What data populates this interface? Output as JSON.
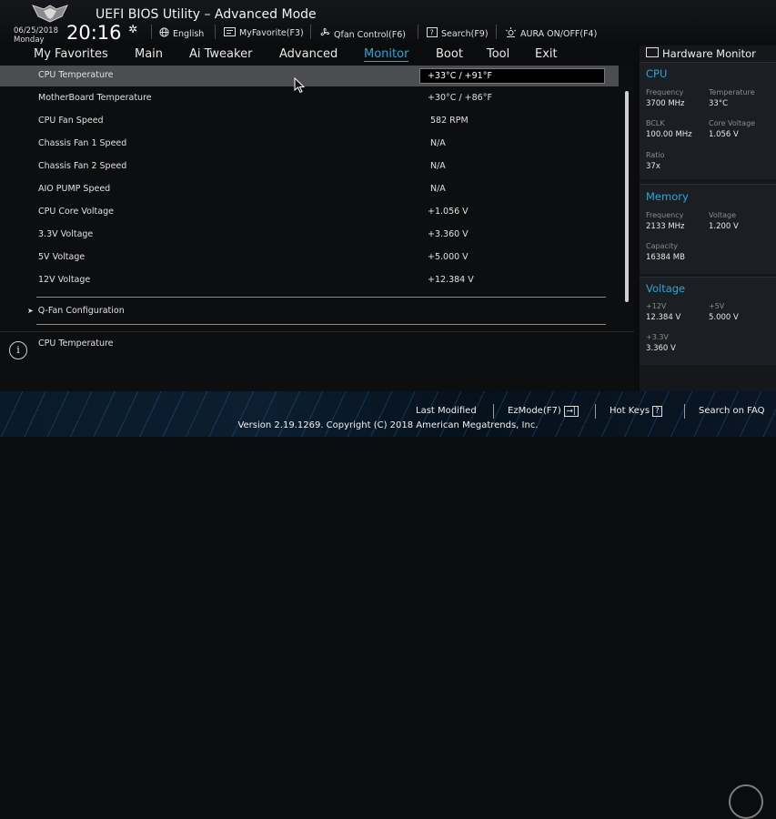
{
  "app": {
    "title": "UEFI BIOS Utility – Advanced Mode",
    "date": "06/25/2018",
    "day": "Monday",
    "time": "20:16"
  },
  "toolbar": [
    {
      "label": "English",
      "icon": "globe-icon"
    },
    {
      "label": "MyFavorite(F3)",
      "icon": "favorite-icon"
    },
    {
      "label": "Qfan Control(F6)",
      "icon": "fan-icon"
    },
    {
      "label": "Search(F9)",
      "icon": "search-icon"
    },
    {
      "label": "AURA ON/OFF(F4)",
      "icon": "aura-icon"
    }
  ],
  "nav": {
    "tabs": [
      "My Favorites",
      "Main",
      "Ai Tweaker",
      "Advanced",
      "Monitor",
      "Boot",
      "Tool",
      "Exit"
    ],
    "active": "Monitor"
  },
  "monitor": {
    "rows": [
      {
        "label": "CPU Temperature",
        "value": "+33°C / +91°F"
      },
      {
        "label": "MotherBoard Temperature",
        "value": "+30°C / +86°F"
      },
      {
        "label": "CPU Fan Speed",
        "value": "582 RPM"
      },
      {
        "label": "Chassis Fan 1 Speed",
        "value": "N/A"
      },
      {
        "label": "Chassis Fan 2 Speed",
        "value": "N/A"
      },
      {
        "label": "AIO PUMP Speed",
        "value": "N/A"
      },
      {
        "label": "CPU Core Voltage",
        "value": "+1.056 V"
      },
      {
        "label": "3.3V Voltage",
        "value": "+3.360 V"
      },
      {
        "label": "5V Voltage",
        "value": "+5.000 V"
      },
      {
        "label": "12V Voltage",
        "value": "+12.384 V"
      }
    ],
    "submenu": "Q-Fan Configuration",
    "submenu_arrow": "➤"
  },
  "help": {
    "icon_glyph": "i",
    "text": "CPU Temperature"
  },
  "hardware_monitor": {
    "title": "Hardware Monitor",
    "cpu": {
      "heading": "CPU",
      "frequency_label": "Frequency",
      "frequency": "3700 MHz",
      "temperature_label": "Temperature",
      "temperature": "33°C",
      "bclk_label": "BCLK",
      "bclk": "100.00 MHz",
      "core_voltage_label": "Core Voltage",
      "core_voltage": "1.056 V",
      "ratio_label": "Ratio",
      "ratio": "37x"
    },
    "memory": {
      "heading": "Memory",
      "frequency_label": "Frequency",
      "frequency": "2133 MHz",
      "voltage_label": "Voltage",
      "voltage": "1.200 V",
      "capacity_label": "Capacity",
      "capacity": "16384 MB"
    },
    "voltage": {
      "heading": "Voltage",
      "v12_label": "+12V",
      "v12": "12.384 V",
      "v5_label": "+5V",
      "v5": "5.000 V",
      "v33_label": "+3.3V",
      "v33": "3.360 V"
    }
  },
  "footer": {
    "last_modified": "Last Modified",
    "ezmode": "EzMode(F7)",
    "ezmode_glyph": "→|",
    "hotkeys": "Hot Keys",
    "hotkeys_glyph": "?",
    "search_faq": "Search on FAQ",
    "version": "Version 2.19.1269. Copyright (C) 2018 American Megatrends, Inc."
  },
  "colors": {
    "accent": "#2aa7d8",
    "selected_row": "#4b4d51",
    "background": "#0d0e10",
    "sidebar": "#15171a"
  }
}
